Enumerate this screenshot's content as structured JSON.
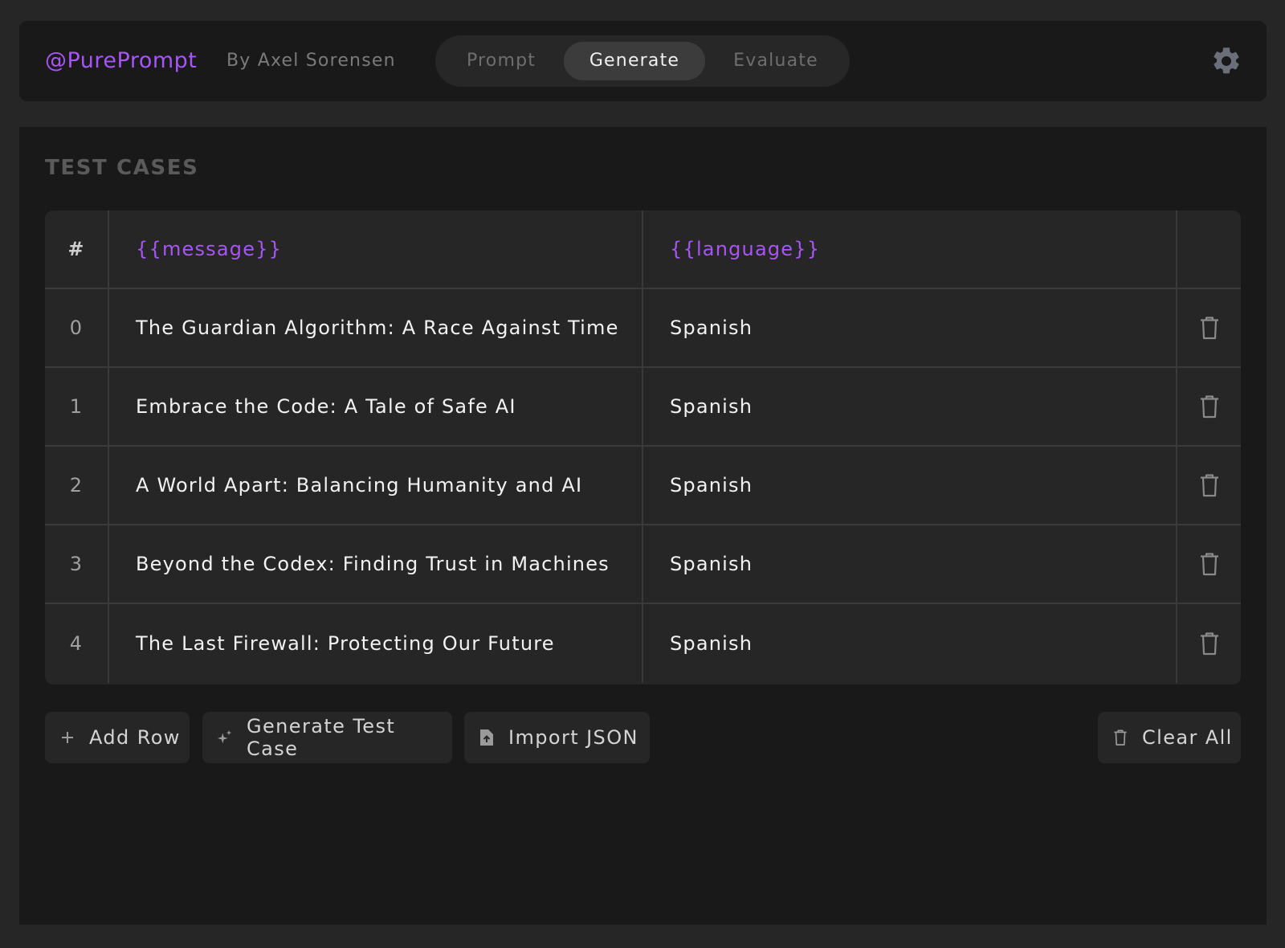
{
  "header": {
    "brand": "@PurePrompt",
    "author": "By Axel Sorensen",
    "tabs": [
      {
        "label": "Prompt",
        "active": false
      },
      {
        "label": "Generate",
        "active": true
      },
      {
        "label": "Evaluate",
        "active": false
      }
    ],
    "settings_icon": "gear-icon"
  },
  "test_cases": {
    "title": "TEST CASES",
    "columns": [
      "#",
      "{{message}}",
      "{{language}}",
      ""
    ],
    "rows": [
      {
        "index": "0",
        "message": "The Guardian Algorithm: A Race Against Time",
        "language": "Spanish"
      },
      {
        "index": "1",
        "message": "Embrace the Code: A Tale of Safe AI",
        "language": "Spanish"
      },
      {
        "index": "2",
        "message": "A World Apart: Balancing Humanity and AI",
        "language": "Spanish"
      },
      {
        "index": "3",
        "message": "Beyond the Codex: Finding Trust in Machines",
        "language": "Spanish"
      },
      {
        "index": "4",
        "message": "The Last Firewall: Protecting Our Future",
        "language": "Spanish"
      }
    ],
    "row_action_icon": "trash-icon"
  },
  "actions": {
    "add_row": "Add Row",
    "generate_test_case": "Generate Test Case",
    "import_json": "Import JSON",
    "clear_all": "Clear All"
  },
  "colors": {
    "accent": "#a855f7",
    "background": "#262626",
    "panel": "#191919"
  }
}
